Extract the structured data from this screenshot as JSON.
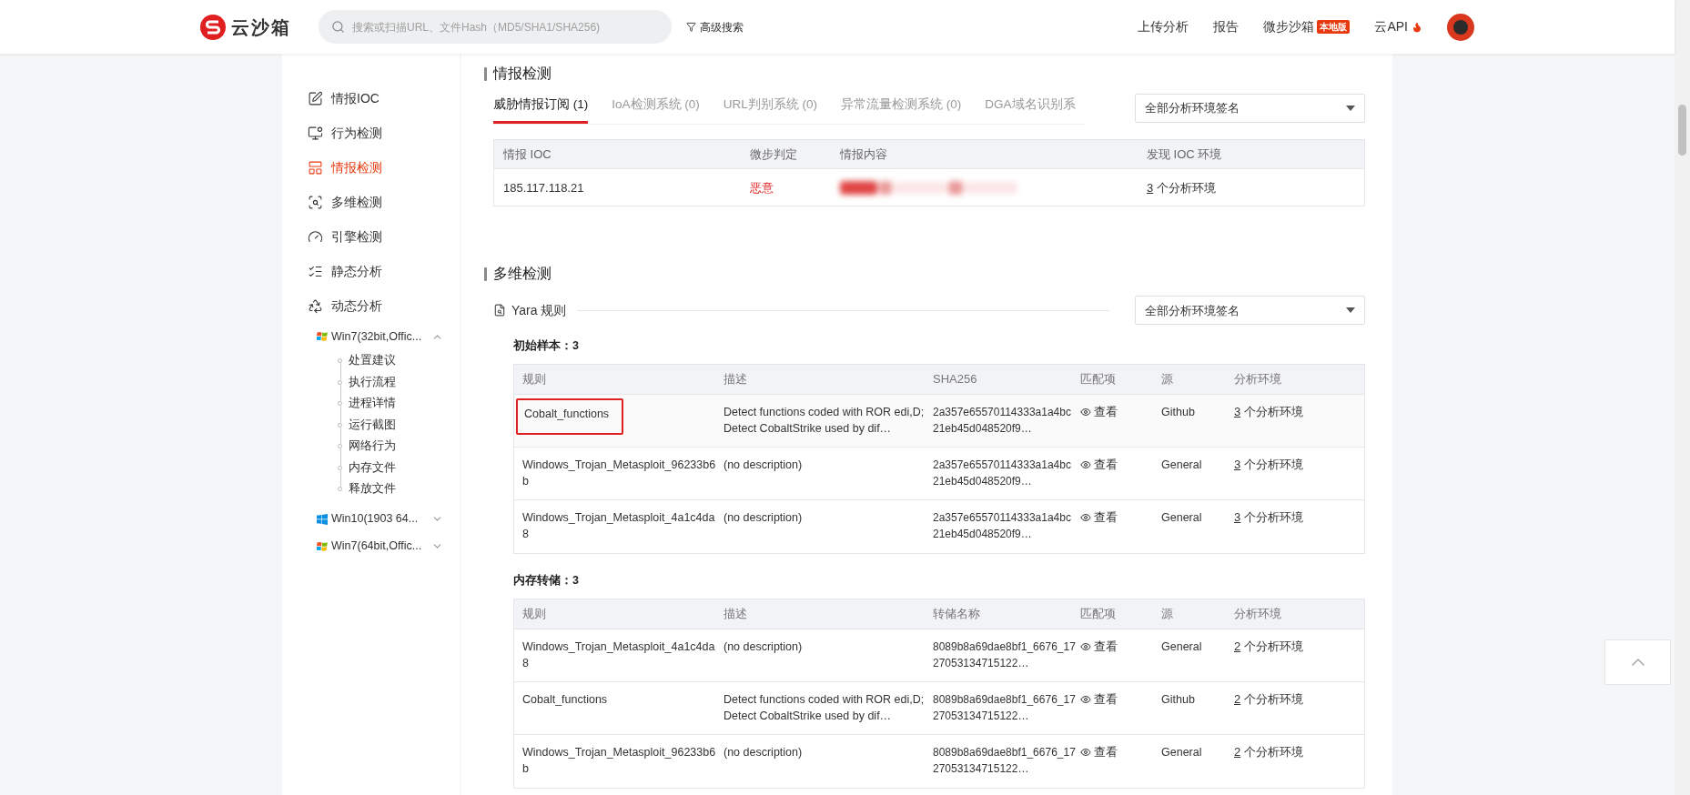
{
  "header": {
    "logo_text": "云沙箱",
    "search": {
      "placeholder": "搜索或扫描URL、文件Hash（MD5/SHA1/SHA256)"
    },
    "advanced_search": "高级搜索",
    "nav": [
      {
        "label": "上传分析",
        "kind": "plain"
      },
      {
        "label": "报告",
        "kind": "plain"
      },
      {
        "label": "微步沙箱",
        "kind": "badge",
        "badge": "本地版"
      },
      {
        "label": "云API",
        "kind": "flame"
      }
    ]
  },
  "sidebar": {
    "items": [
      {
        "label": "情报IOC",
        "selected": false
      },
      {
        "label": "行为检测",
        "selected": false
      },
      {
        "label": "情报检测",
        "selected": true
      },
      {
        "label": "多维检测",
        "selected": false
      },
      {
        "label": "引擎检测",
        "selected": false
      },
      {
        "label": "静态分析",
        "selected": false
      },
      {
        "label": "动态分析",
        "selected": false,
        "children": [
          {
            "label": "Win7(32bit,Offic...",
            "kind": "win7",
            "expanded": true,
            "children": [
              {
                "label": "处置建议"
              },
              {
                "label": "执行流程"
              },
              {
                "label": "进程详情"
              },
              {
                "label": "运行截图"
              },
              {
                "label": "网络行为"
              },
              {
                "label": "内存文件"
              },
              {
                "label": "释放文件"
              }
            ]
          },
          {
            "label": "Win10(1903 64...",
            "kind": "win10",
            "expanded": false
          },
          {
            "label": "Win7(64bit,Offic...",
            "kind": "win7",
            "expanded": false
          }
        ]
      }
    ]
  },
  "intel": {
    "title": "情报检测",
    "tabs": [
      {
        "label": "威胁情报订阅 (1)",
        "selected": true
      },
      {
        "label": "IoA检测系统 (0)",
        "selected": false
      },
      {
        "label": "URL判别系统 (0)",
        "selected": false
      },
      {
        "label": "异常流量检测系统 (0)",
        "selected": false
      },
      {
        "label": "DGA域名识别系",
        "selected": false
      }
    ],
    "filter": "全部分析环境签名",
    "columns": [
      "情报 IOC",
      "微步判定",
      "情报内容",
      "发现 IOC 环境"
    ],
    "rows": [
      {
        "ioc": "185.117.118.21",
        "verdict": "恶意",
        "kind": "malicious",
        "env_count": "3",
        "env_label": "个分析环境"
      }
    ]
  },
  "multi": {
    "title": "多维检测",
    "yara_title": "Yara 规则",
    "filter": "全部分析环境签名",
    "groups": [
      {
        "title": "初始样本：3",
        "columns": [
          "规则",
          "描述",
          "SHA256",
          "匹配项",
          "源",
          "分析环境"
        ],
        "rows": [
          {
            "rule": "Cobalt_functions",
            "description": "Detect functions coded with ROR edi,D; Detect CobaltStrike used by dif…",
            "hash": "2a357e65570114333a1a4bc21eb45d048520f9…",
            "match": "查看",
            "source": "Github",
            "env_count": "3",
            "env_label": "个分析环境",
            "highlighted": true
          },
          {
            "rule": "Windows_Trojan_Metasploit_96233b6b",
            "description": "(no description)",
            "hash": "2a357e65570114333a1a4bc21eb45d048520f9…",
            "match": "查看",
            "source": "General",
            "env_count": "3",
            "env_label": "个分析环境",
            "highlighted": false
          },
          {
            "rule": "Windows_Trojan_Metasploit_4a1c4da8",
            "description": "(no description)",
            "hash": "2a357e65570114333a1a4bc21eb45d048520f9…",
            "match": "查看",
            "source": "General",
            "env_count": "3",
            "env_label": "个分析环境",
            "highlighted": false
          }
        ]
      },
      {
        "title": "内存转储：3",
        "columns": [
          "规则",
          "描述",
          "转储名称",
          "匹配项",
          "源",
          "分析环境"
        ],
        "rows": [
          {
            "rule": "Windows_Trojan_Metasploit_4a1c4da8",
            "description": "(no description)",
            "hash": "8089b8a69dae8bf1_6676_1727053134715122…",
            "match": "查看",
            "source": "General",
            "env_count": "2",
            "env_label": "个分析环境",
            "highlighted": false
          },
          {
            "rule": "Cobalt_functions",
            "description": "Detect functions coded with ROR edi,D; Detect CobaltStrike used by dif…",
            "hash": "8089b8a69dae8bf1_6676_1727053134715122…",
            "match": "查看",
            "source": "Github",
            "env_count": "2",
            "env_label": "个分析环境",
            "highlighted": false
          },
          {
            "rule": "Windows_Trojan_Metasploit_96233b6b",
            "description": "(no description)",
            "hash": "8089b8a69dae8bf1_6676_1727053134715122…",
            "match": "查看",
            "source": "General",
            "env_count": "2",
            "env_label": "个分析环境",
            "highlighted": false
          }
        ]
      }
    ]
  }
}
